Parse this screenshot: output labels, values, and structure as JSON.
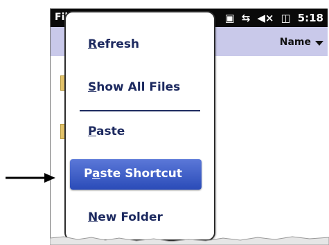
{
  "statusbar": {
    "title": "File Explorer",
    "time": "5:18",
    "icons": [
      "signal-icon",
      "sync-icon",
      "volume-icon",
      "battery-icon"
    ]
  },
  "list_header": {
    "name_label": "Name"
  },
  "context_menu": {
    "items": [
      {
        "accel": "R",
        "rest": "efresh"
      },
      {
        "accel": "S",
        "rest": "how All Files"
      },
      {
        "accel": "P",
        "rest": "aste"
      },
      {
        "pre": "P",
        "accel": "a",
        "rest": "ste Shortcut",
        "highlighted": true
      },
      {
        "accel": "N",
        "rest": "ew Folder"
      }
    ]
  },
  "colors": {
    "statusbar_bg": "#0a0a0a",
    "header_bg": "#c9c9ea",
    "menu_text": "#1d2a60",
    "highlight": "#2a4bb8"
  }
}
